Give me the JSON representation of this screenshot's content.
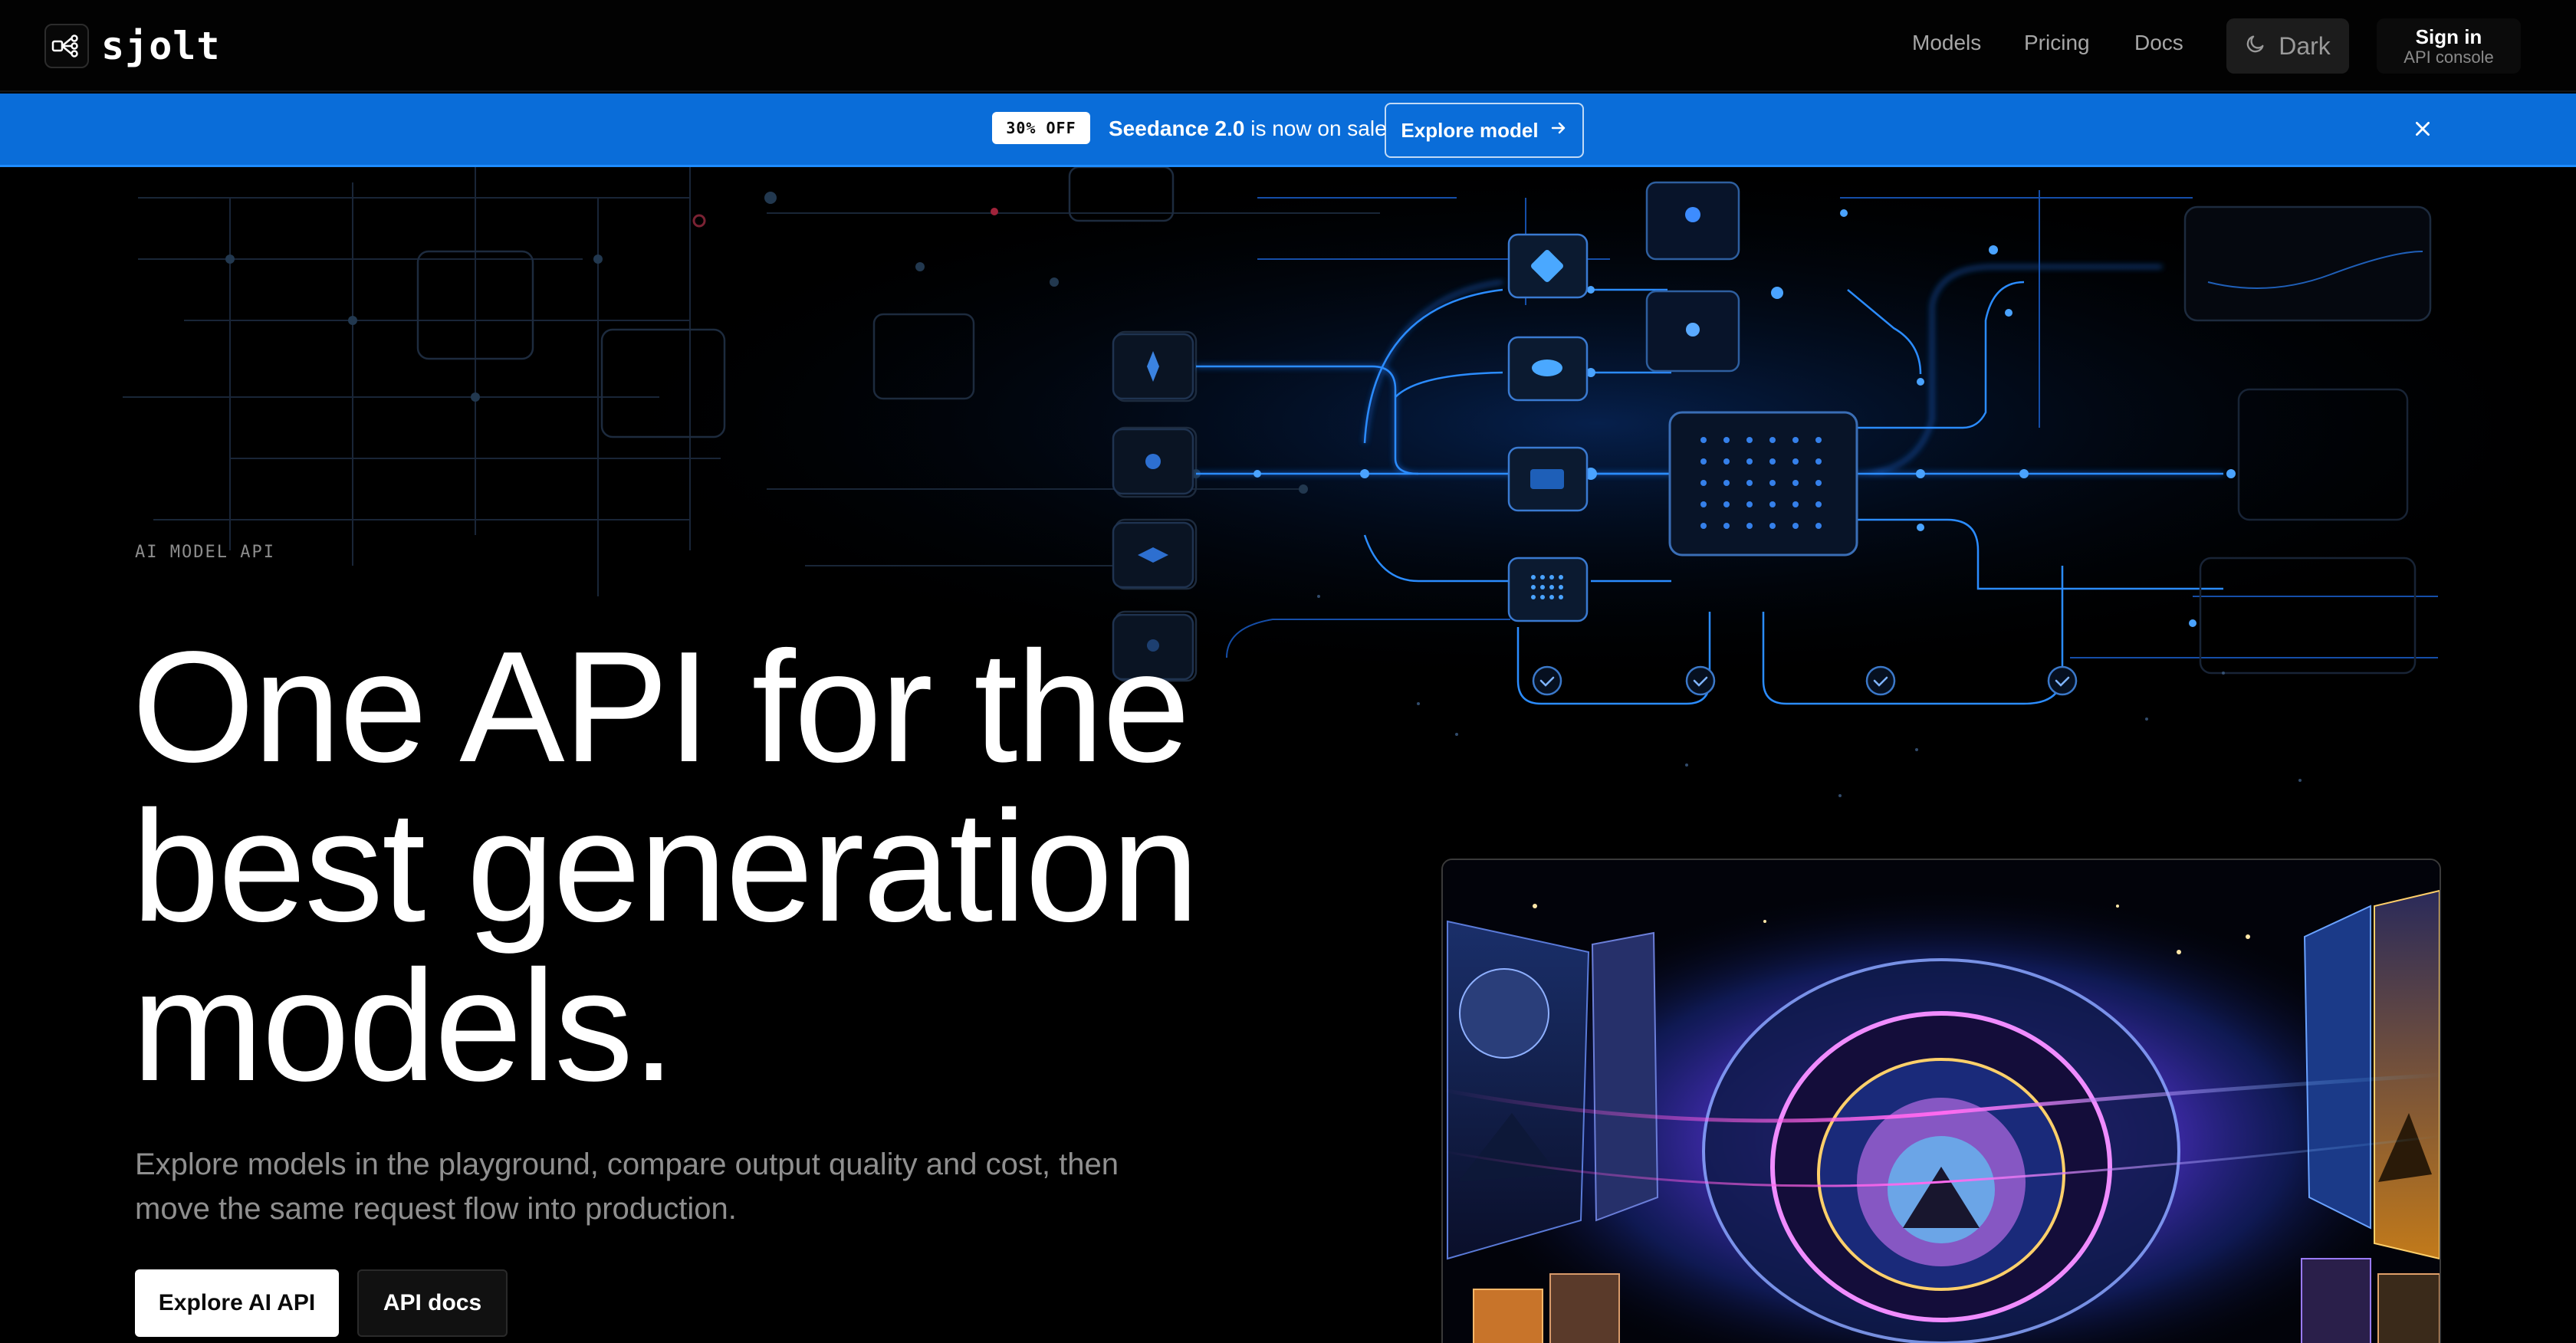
{
  "nav": {
    "logo_text": "sjolt",
    "links": [
      {
        "label": "Models"
      },
      {
        "label": "Pricing"
      },
      {
        "label": "Docs"
      }
    ],
    "theme_label": "Dark",
    "signin_title": "Sign in",
    "signin_subtitle": "API console"
  },
  "banner": {
    "badge": "30% OFF",
    "model_name": "Seedance 2.0",
    "message": " is now on sale",
    "cta_label": "Explore model"
  },
  "hero": {
    "eyebrow": "AI MODEL API",
    "headline_line1": "One API for the",
    "headline_line2": "best generation",
    "headline_line3": "models.",
    "subcopy": "Explore models in the playground, compare output quality and cost, then move the same request flow into production.",
    "primary_cta": "Explore AI API",
    "secondary_cta": "API docs"
  },
  "colors": {
    "banner_bg": "#0a6dd9",
    "accent_glow": "#2b8cff",
    "background": "#000000"
  },
  "icons": [
    "logo-icon",
    "moon-icon",
    "arrow-right-icon",
    "close-icon",
    "check-icon",
    "chip-icon"
  ]
}
